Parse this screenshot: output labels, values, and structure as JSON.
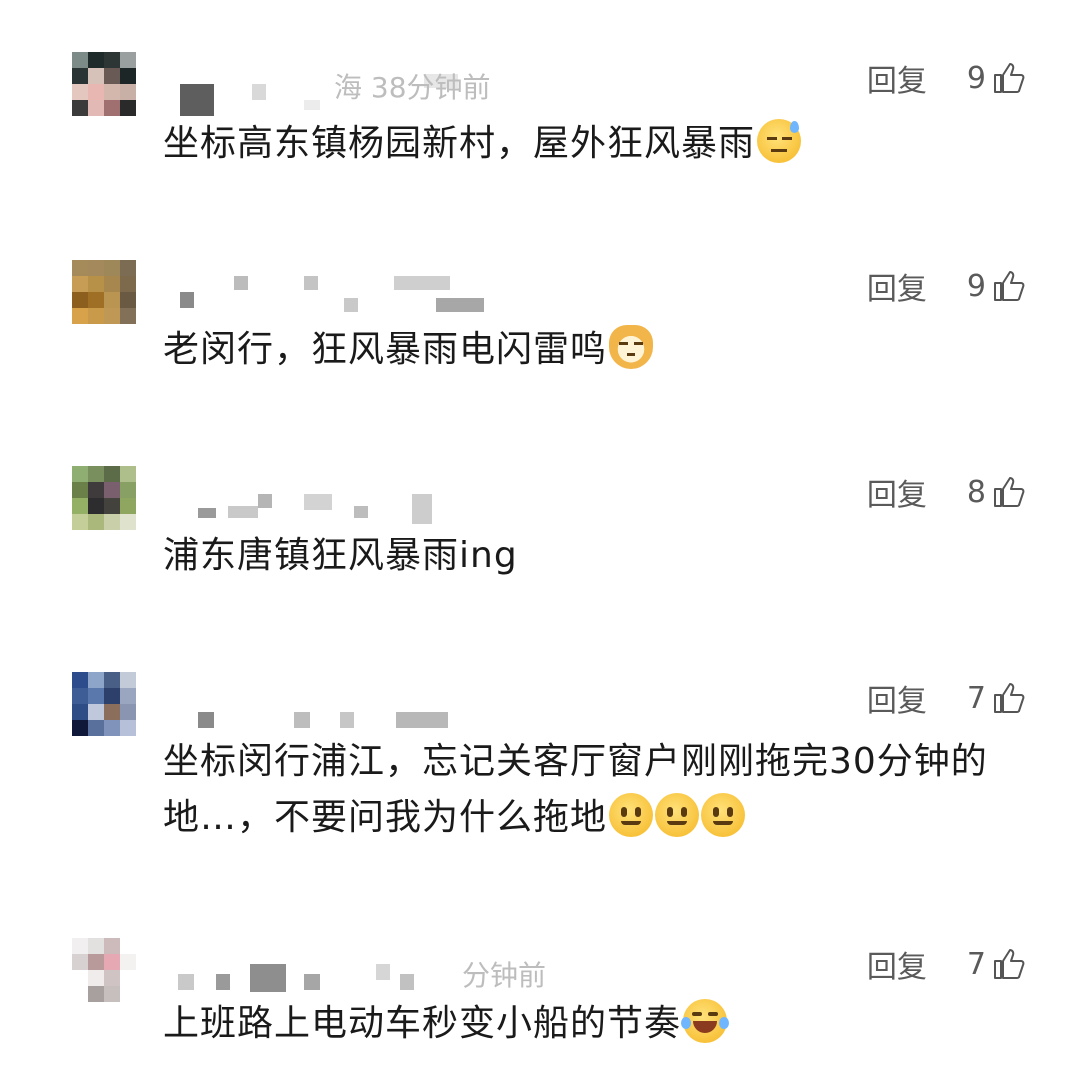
{
  "reply_label": "回复",
  "comments": [
    {
      "time": "海 38分钟前",
      "likes": "9",
      "text": "坐标高东镇杨园新村，屋外狂风暴雨",
      "emoji": "sweat-smile-emoji"
    },
    {
      "time": "",
      "likes": "9",
      "text": "老闵行，狂风暴雨电闪雷鸣",
      "emoji": "cat-emoji"
    },
    {
      "time": "",
      "likes": "8",
      "text": "浦东唐镇狂风暴雨ing",
      "emoji": ""
    },
    {
      "time": "",
      "likes": "7",
      "text": "坐标闵行浦江，忘记关客厅窗户刚刚拖完30分钟的地…，不要问我为什么拖地",
      "emoji": "smile-emoji x3"
    },
    {
      "time": "分钟前",
      "likes": "7",
      "text": "上班路上电动车秒变小船的节奏",
      "emoji": "tears-of-joy-emoji"
    }
  ],
  "colors": {
    "accent_gray": "#5a5a5a",
    "text": "#1a1a1a",
    "blur": "#d9d9d9"
  }
}
